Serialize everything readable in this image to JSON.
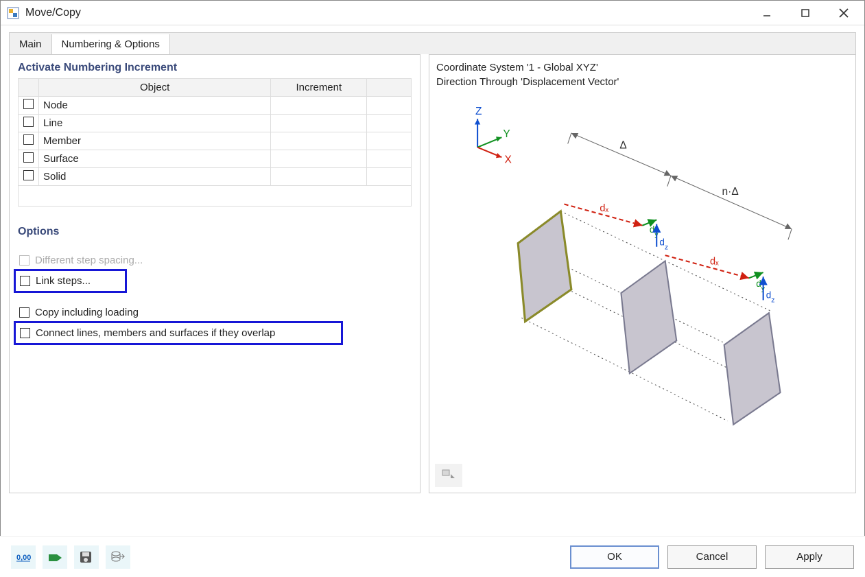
{
  "window": {
    "title": "Move/Copy"
  },
  "tabs": {
    "main": "Main",
    "numbering": "Numbering & Options"
  },
  "numbering": {
    "section_title": "Activate Numbering Increment",
    "col_object": "Object",
    "col_increment": "Increment",
    "rows": [
      {
        "label": "Node"
      },
      {
        "label": "Line"
      },
      {
        "label": "Member"
      },
      {
        "label": "Surface"
      },
      {
        "label": "Solid"
      }
    ]
  },
  "options": {
    "section_title": "Options",
    "different_spacing": "Different step spacing...",
    "link_steps": "Link steps...",
    "copy_loading": "Copy including loading",
    "connect_overlap": "Connect lines, members and surfaces if they overlap"
  },
  "preview": {
    "line1": "Coordinate System '1 - Global XYZ'",
    "line2": "Direction Through 'Displacement Vector'",
    "axis_z": "Z",
    "axis_y": "Y",
    "axis_x": "X",
    "delta": "Δ",
    "n_delta": "n·Δ",
    "dx": "dₓ",
    "dy": "d_y",
    "dz": "d_z"
  },
  "footer": {
    "ok": "OK",
    "cancel": "Cancel",
    "apply": "Apply"
  }
}
